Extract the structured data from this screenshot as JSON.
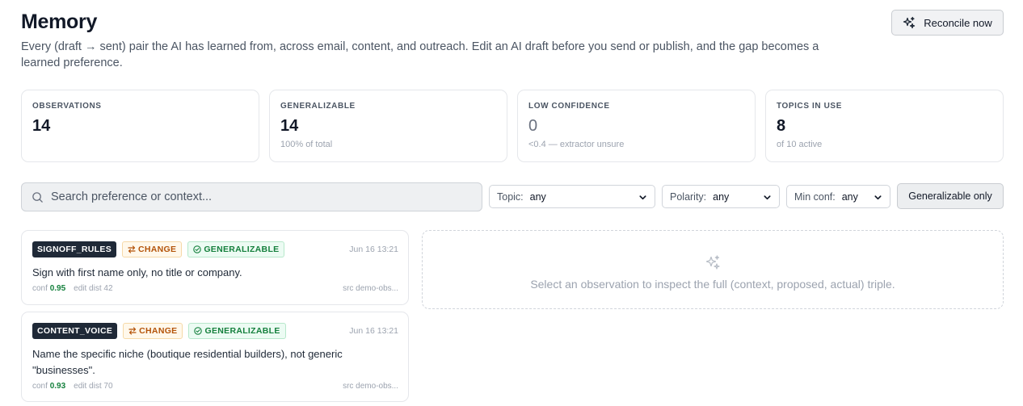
{
  "header": {
    "title": "Memory",
    "description": "Every (draft → sent) pair the AI has learned from, across email, content, and outreach. Edit an AI draft before you send or publish, and the gap becomes a learned preference.",
    "reconcile_label": "Reconcile now"
  },
  "stats": [
    {
      "label": "OBSERVATIONS",
      "value": "14",
      "sub": ""
    },
    {
      "label": "GENERALIZABLE",
      "value": "14",
      "sub": "100% of total"
    },
    {
      "label": "LOW CONFIDENCE",
      "value": "0",
      "sub": "<0.4 — extractor unsure"
    },
    {
      "label": "TOPICS IN USE",
      "value": "8",
      "sub": "of 10 active"
    }
  ],
  "filters": {
    "search_placeholder": "Search preference or context...",
    "topic": {
      "label": "Topic:",
      "value": "any"
    },
    "polarity": {
      "label": "Polarity:",
      "value": "any"
    },
    "min_conf": {
      "label": "Min conf:",
      "value": "any"
    },
    "generalizable_label": "Generalizable only"
  },
  "observations": [
    {
      "topic": "SIGNOFF_RULES",
      "type": "CHANGE",
      "scope": "GENERALIZABLE",
      "time": "Jun 16 13:21",
      "text": "Sign with first name only, no title or company.",
      "conf_label": "conf",
      "conf": "0.95",
      "edit_dist": "edit dist 42",
      "src": "src demo-obs..."
    },
    {
      "topic": "CONTENT_VOICE",
      "type": "CHANGE",
      "scope": "GENERALIZABLE",
      "time": "Jun 16 13:21",
      "text": "Name the specific niche (boutique residential builders), not generic \"businesses\".",
      "conf_label": "conf",
      "conf": "0.93",
      "edit_dist": "edit dist 70",
      "src": "src demo-obs..."
    }
  ],
  "inspector": {
    "empty_text": "Select an observation to inspect the full (context, proposed, actual) triple."
  },
  "colors": {
    "topic_badge": "#1f2937",
    "change_badge": "#b45309",
    "generalizable_badge": "#15803d"
  }
}
